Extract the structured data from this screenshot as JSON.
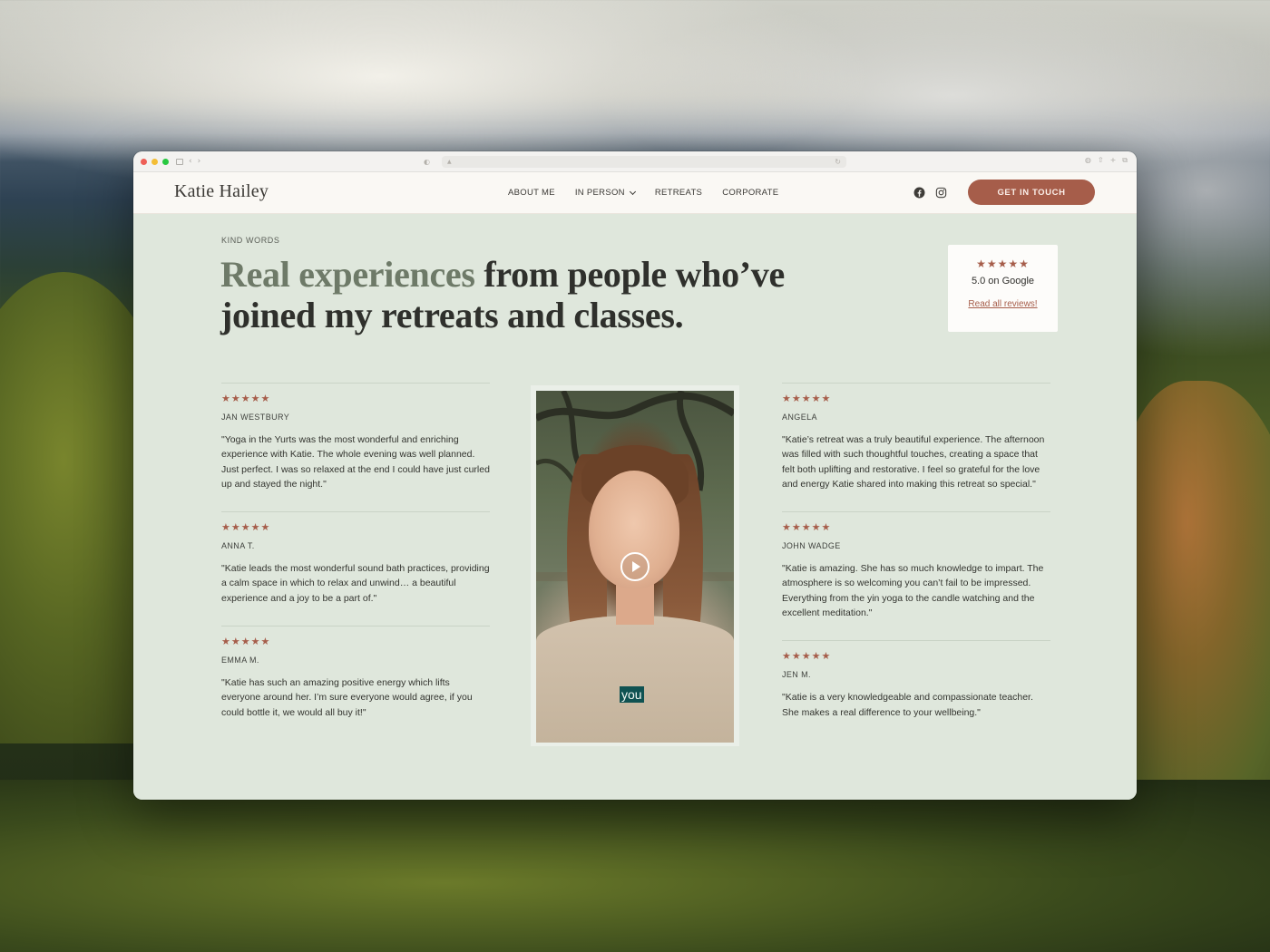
{
  "site": {
    "logo": "Katie Hailey",
    "nav": [
      {
        "label": "ABOUT ME"
      },
      {
        "label": "IN PERSON"
      },
      {
        "label": "RETREATS"
      },
      {
        "label": "CORPORATE"
      }
    ],
    "social": [
      "facebook-icon",
      "instagram-icon"
    ],
    "cta_label": "GET IN TOUCH"
  },
  "colors": {
    "accent": "#a65d4a",
    "section_bg": "#dfe7dc",
    "header_bg": "#faf8f4"
  },
  "section": {
    "eyebrow": "KIND WORDS",
    "headline_muted": "Real experiences",
    "headline_rest": " from people who’ve joined my retreats and classes."
  },
  "google": {
    "stars": "★★★★★",
    "rating_value": 5,
    "rating": "5.0 on Google",
    "link": "Read all reviews!"
  },
  "reviews_left": [
    {
      "stars": "★★★★★",
      "rating": 5,
      "name": "JAN WESTBURY",
      "text": "\"Yoga in the Yurts was the most wonderful and enriching experience with Katie. The whole evening was well planned. Just perfect. I was so relaxed at the end I could have just curled up and stayed the night.\""
    },
    {
      "stars": "★★★★★",
      "rating": 5,
      "name": "ANNA T.",
      "text": "\"Katie leads the most wonderful sound bath practices, providing a calm space in which to relax and unwind… a beautiful experience and a joy to be a part of.\""
    },
    {
      "stars": "★★★★★",
      "rating": 5,
      "name": "EMMA M.",
      "text": "\"Katie has such an amazing positive energy which lifts everyone around her. I’m sure everyone would agree, if you could bottle it, we would all buy it!\""
    }
  ],
  "reviews_right": [
    {
      "stars": "★★★★★",
      "rating": 5,
      "name": "ANGELA",
      "text": "\"Katie’s retreat was a truly beautiful experience. The afternoon was filled with such thoughtful touches, creating a space that felt both uplifting and restorative. I feel so grateful for the love and energy Katie shared into making this retreat so special.\""
    },
    {
      "stars": "★★★★★",
      "rating": 5,
      "name": "JOHN WADGE",
      "text": "\"Katie is amazing. She has so much knowledge to impart. The atmosphere is so welcoming you can’t fail to be impressed. Everything from the yin yoga to the candle watching and the excellent meditation.\""
    },
    {
      "stars": "★★★★★",
      "rating": 5,
      "name": "JEN M.",
      "text": "\"Katie is a very knowledgeable and compassionate teacher. She makes a real difference to your wellbeing.\""
    }
  ],
  "video": {
    "caption": "you",
    "icon": "play-icon"
  }
}
